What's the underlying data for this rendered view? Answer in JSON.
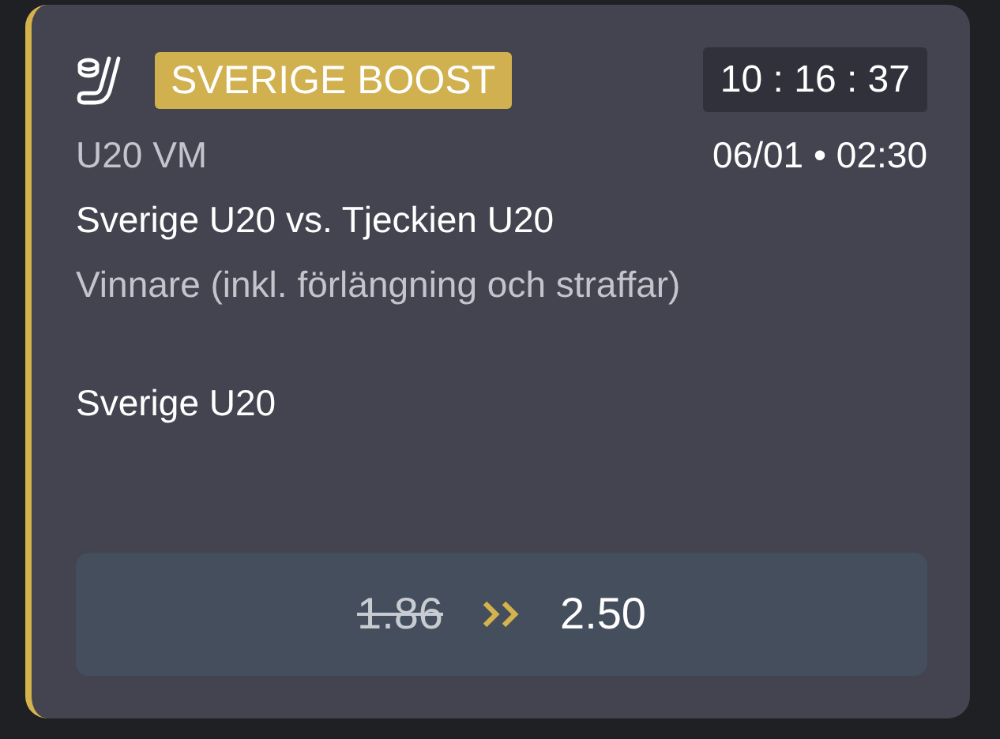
{
  "badge": "SVERIGE BOOST",
  "countdown": "10 : 16 : 37",
  "competition": "U20 VM",
  "start_time": "06/01 • 02:30",
  "match": "Sverige U20 vs. Tjeckien U20",
  "market": "Vinnare (inkl. förlängning och straffar)",
  "selection": "Sverige U20",
  "odds": {
    "old": "1.86",
    "new": "2.50"
  }
}
